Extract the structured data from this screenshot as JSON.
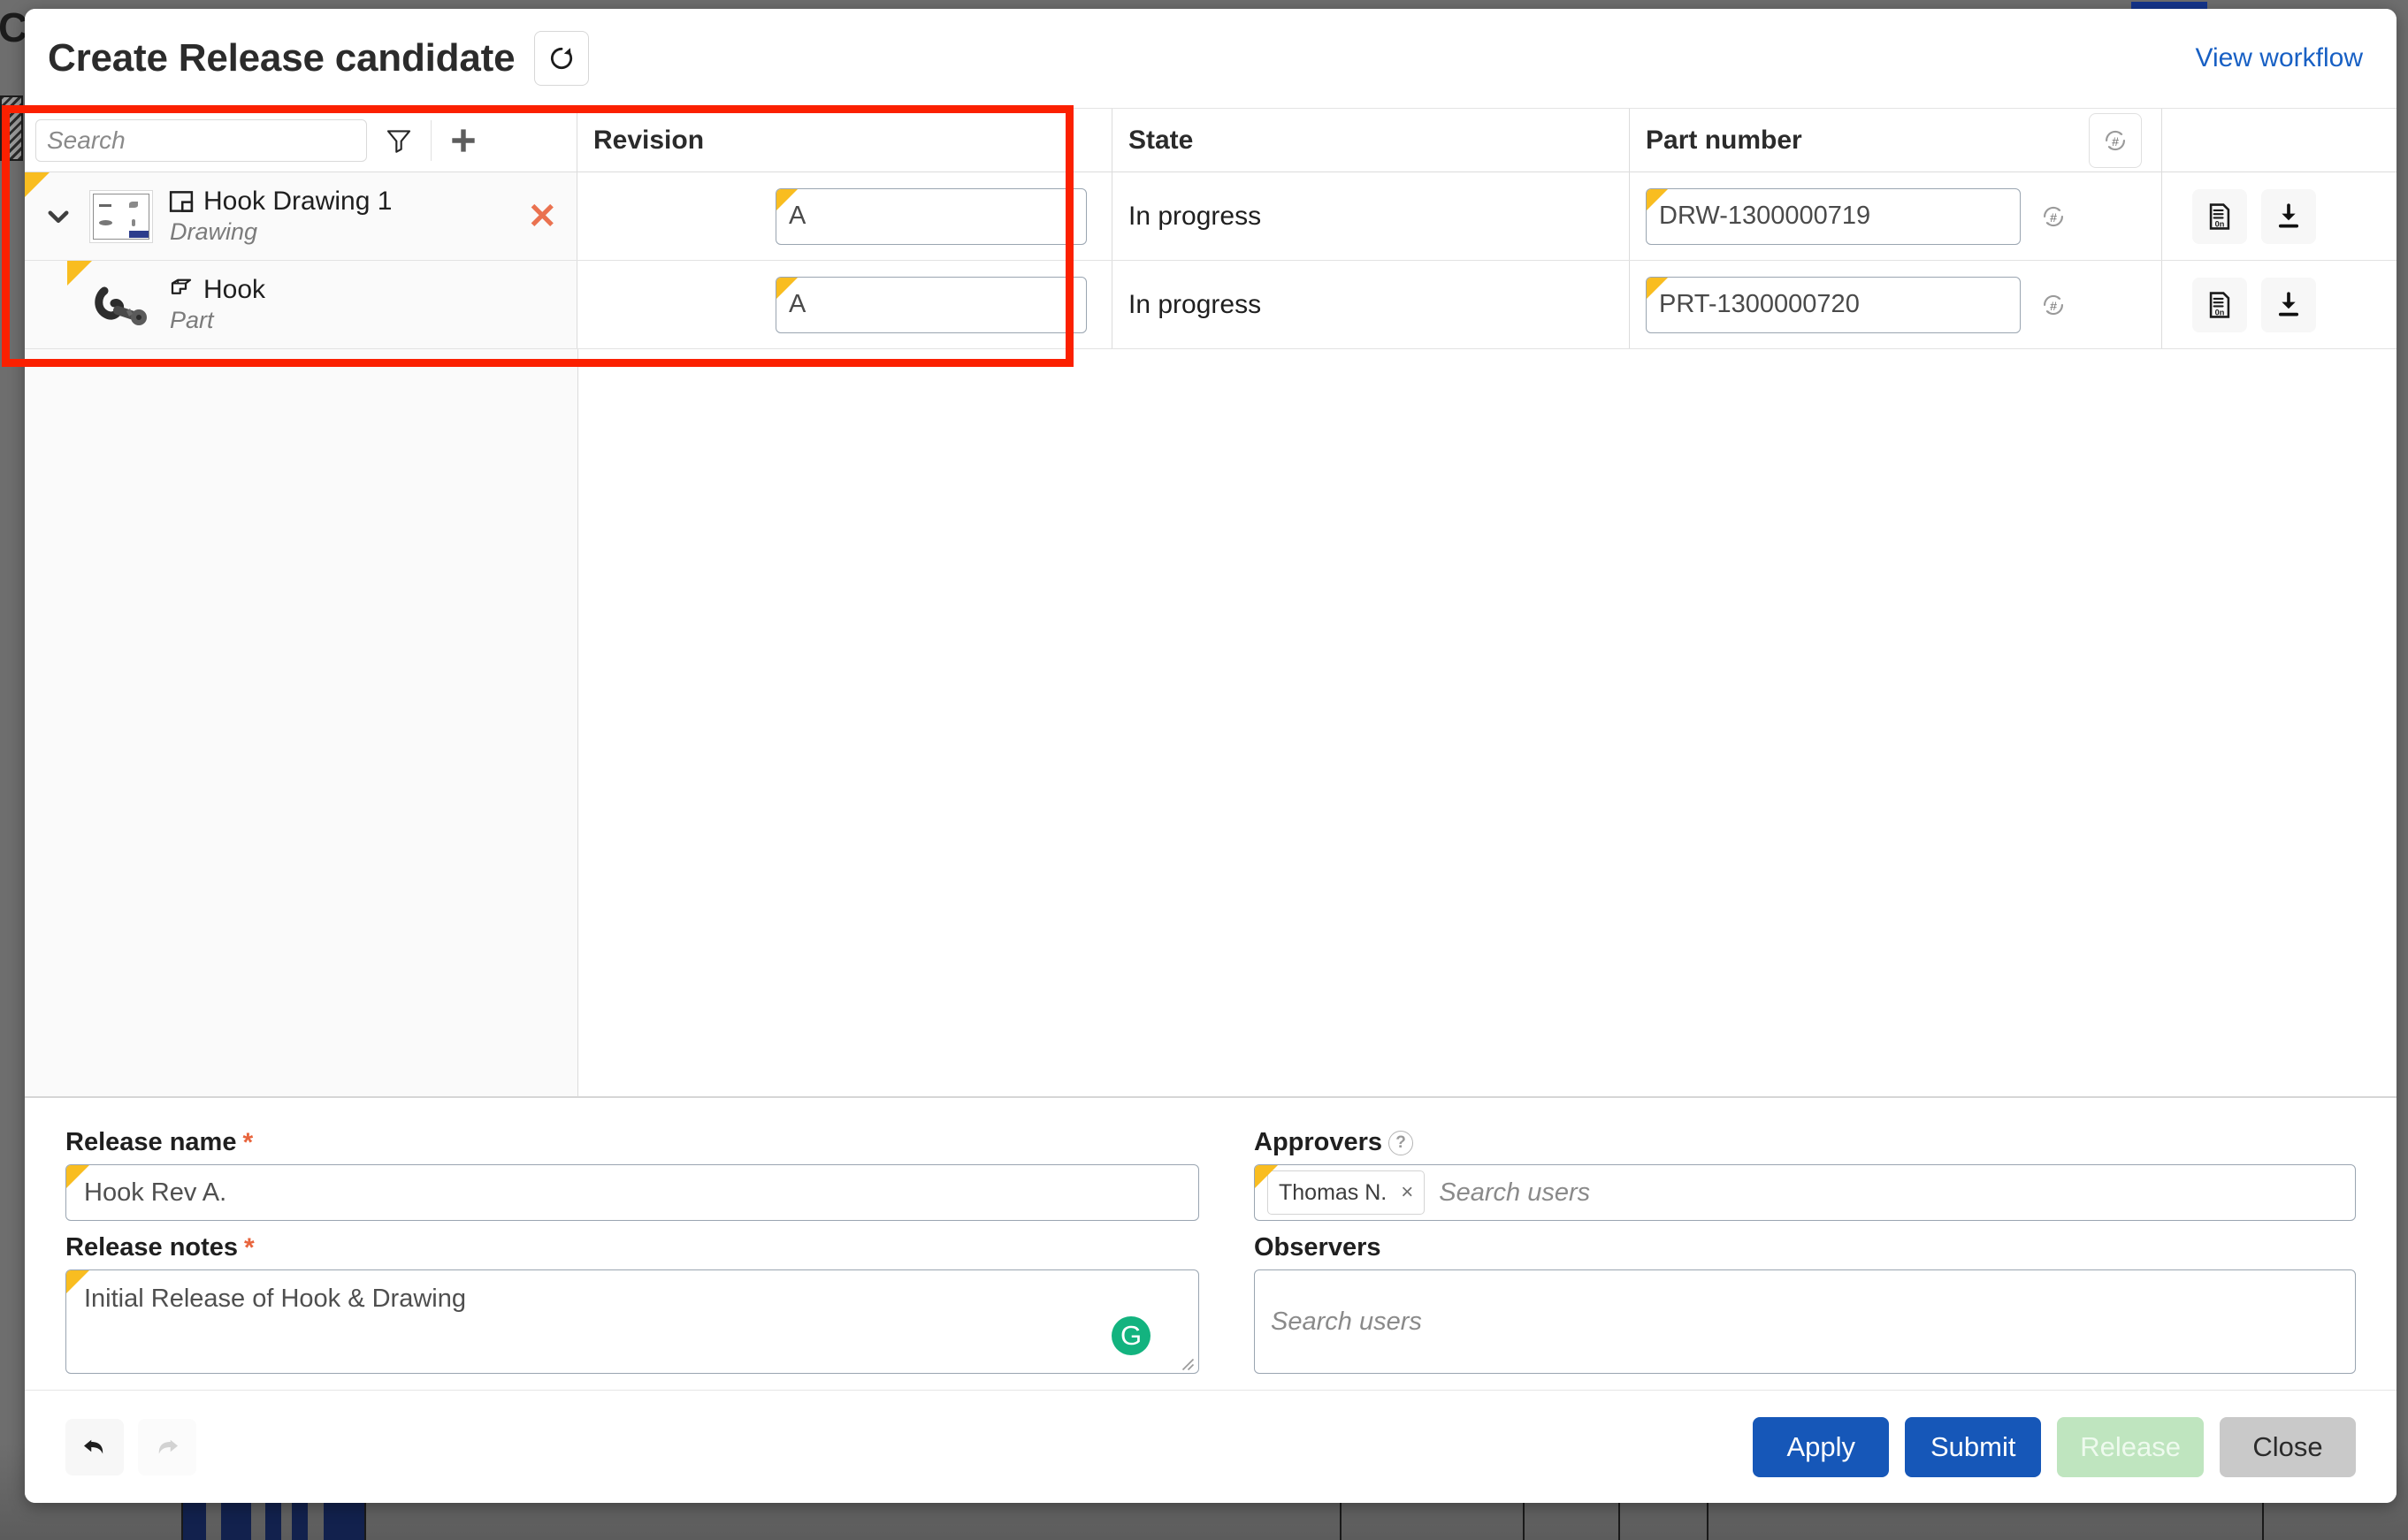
{
  "dialog": {
    "title": "Create Release candidate",
    "refresh_icon": "refresh-icon",
    "view_workflow_link": "View workflow"
  },
  "table": {
    "search": {
      "placeholder": "Search",
      "value": ""
    },
    "filter_icon": "filter-icon",
    "add_icon": "plus-icon",
    "columns": [
      {
        "key": "name",
        "label": ""
      },
      {
        "key": "rev",
        "label": "Revision"
      },
      {
        "key": "state",
        "label": "State"
      },
      {
        "key": "part",
        "label": "Part number"
      },
      {
        "key": "act",
        "label": ""
      }
    ],
    "part_autonumber_icon": "autonumber-icon",
    "rows": [
      {
        "expand_icon": "chevron-down-icon",
        "thumbnail": "drawing-thumbnail",
        "type_icon": "drawing-icon",
        "name": "Hook Drawing 1",
        "type": "Drawing",
        "remove_icon": "remove-x-icon",
        "revision": "A",
        "state": "In progress",
        "part_number": "DRW-1300000719",
        "autonumber_icon": "autonumber-icon",
        "actions": [
          {
            "icon": "bom-report-icon"
          },
          {
            "icon": "download-icon"
          }
        ],
        "indent": false,
        "has_remove": true
      },
      {
        "expand_icon": "",
        "thumbnail": "hook-part-thumbnail",
        "type_icon": "part-icon",
        "name": "Hook",
        "type": "Part",
        "remove_icon": "",
        "revision": "A",
        "state": "In progress",
        "part_number": "PRT-1300000720",
        "autonumber_icon": "autonumber-icon",
        "actions": [
          {
            "icon": "bom-report-icon"
          },
          {
            "icon": "download-icon"
          }
        ],
        "indent": true,
        "has_remove": false
      }
    ]
  },
  "form": {
    "release_name": {
      "label": "Release name",
      "required_marker": "*",
      "value": "Hook Rev A."
    },
    "release_notes": {
      "label": "Release notes",
      "required_marker": "*",
      "value": "Initial Release of Hook & Drawing",
      "assistant_badge": "G"
    },
    "approvers": {
      "label": "Approvers",
      "help_icon": "help-icon",
      "chips": [
        {
          "name": "Thomas N.",
          "remove": "×"
        }
      ],
      "placeholder": "Search users"
    },
    "observers": {
      "label": "Observers",
      "chips": [],
      "placeholder": "Search users"
    }
  },
  "footer": {
    "undo_icon": "undo-icon",
    "redo_icon": "redo-icon",
    "buttons": [
      {
        "label": "Apply",
        "style": "primary",
        "disabled": false
      },
      {
        "label": "Submit",
        "style": "primary",
        "disabled": false
      },
      {
        "label": "Release",
        "style": "success",
        "disabled": true
      },
      {
        "label": "Close",
        "style": "neutral",
        "disabled": false
      }
    ]
  },
  "annotation": {
    "highlight_color": "#fb2000"
  },
  "colors": {
    "accent_blue": "#1657b8",
    "link_blue": "#1860c4",
    "flag_yellow": "#f9bd20",
    "remove_orange": "#ea7250",
    "release_green": "#bfe5bf",
    "assistant_green": "#13b37f"
  }
}
